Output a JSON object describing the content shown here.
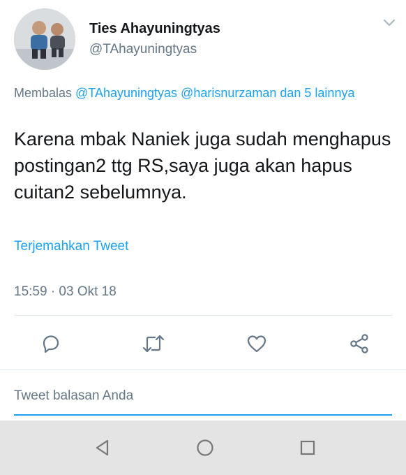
{
  "user": {
    "display_name": "Ties Ahayuningtyas",
    "handle": "@TAhayuningtyas"
  },
  "reply_context": {
    "prefix": "Membalas ",
    "mentions": "@TAhayuningtyas @harisnurzaman dan 5 lainnya"
  },
  "tweet": {
    "text": "Karena mbak Naniek juga sudah menghapus postingan2 ttg RS,saya juga akan hapus cuitan2 sebelumnya.",
    "translate_label": "Terjemahkan Tweet",
    "timestamp": "15:59 · 03 Okt 18"
  },
  "reply_box": {
    "placeholder": "Tweet balasan Anda"
  },
  "icons": {
    "header": "chevron-down-icon",
    "actions": [
      "reply-icon",
      "retweet-icon",
      "like-icon",
      "share-icon"
    ],
    "navbar": [
      "back-triangle-icon",
      "home-circle-icon",
      "recents-square-icon"
    ]
  },
  "colors": {
    "accent": "#1da1f2",
    "secondary_text": "#657786",
    "primary_text": "#14171a",
    "navbar": "#e4e4e4"
  }
}
